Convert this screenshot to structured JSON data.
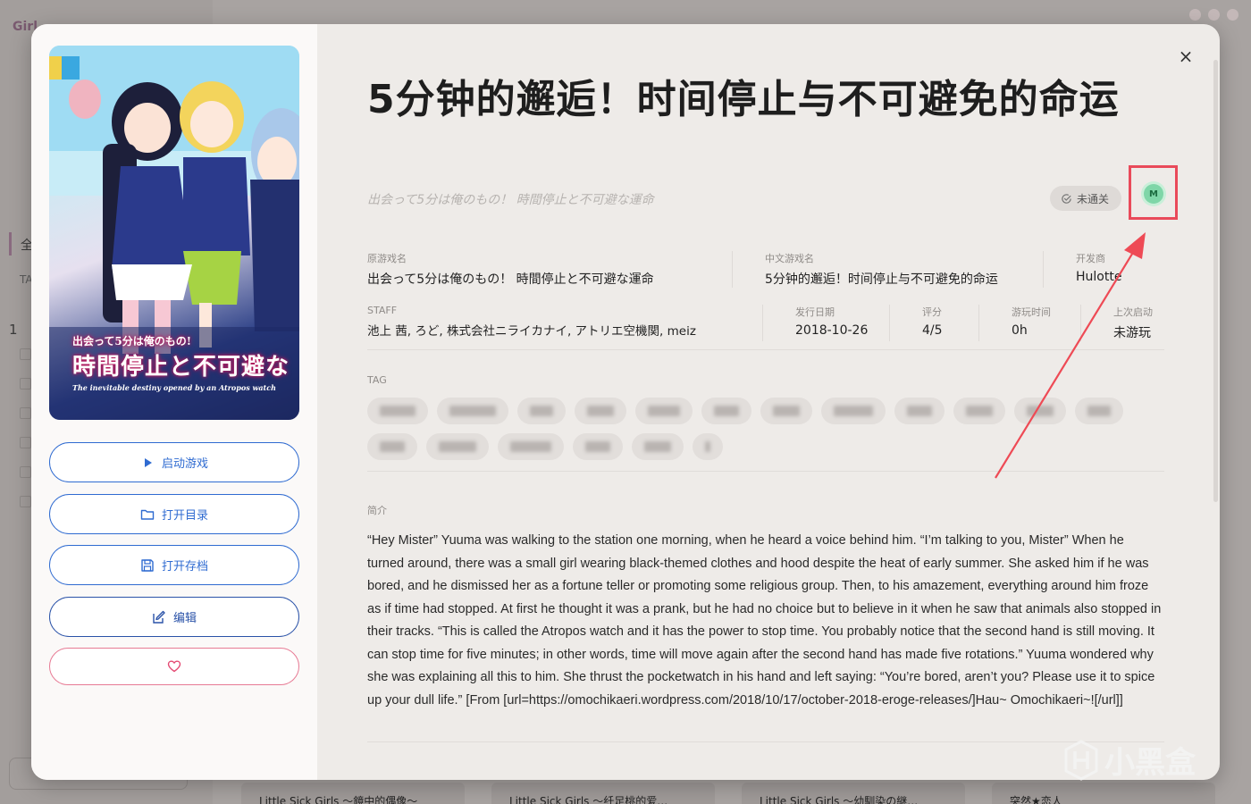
{
  "background": {
    "app_title": "Girl",
    "tab_label": "全",
    "tag_label": "TA",
    "page_number": "1",
    "cards": [
      "Little Sick Girls ～鏡中的偶像～",
      "Little Sick Girls ～纤足桃的爱…",
      "Little Sick Girls ～幼馴染の継…",
      "突然★恋人"
    ]
  },
  "detail": {
    "title": "5分钟的邂逅！时间停止与不可避免的命运",
    "subtitle": "出会って5分は俺のもの！ 時間停止と不可避な運命",
    "status_badge": "未通关",
    "m_badge": "M",
    "close_symbol": "×",
    "info_row1": [
      {
        "label": "原游戏名",
        "value": "出会って5分は俺のもの！ 時間停止と不可避な運命"
      },
      {
        "label": "中文游戏名",
        "value": "5分钟的邂逅！时间停止与不可避免的命运"
      },
      {
        "label": "开发商",
        "value": "Hulotte"
      }
    ],
    "info_row2": [
      {
        "label": "STAFF",
        "value": "池上 茜, ろど, 株式会社ニライカナイ, アトリエ空機関, meiz"
      },
      {
        "label": "发行日期",
        "value": "2018-10-26"
      },
      {
        "label": "评分",
        "value": "4/5"
      },
      {
        "label": "游玩时间",
        "value": "0h"
      },
      {
        "label": "上次启动",
        "value": "未游玩"
      }
    ],
    "tag_section_label": "TAG",
    "desc_section_label": "简介",
    "description": "“Hey Mister” Yuuma was walking to the station one morning, when he heard a voice behind him. “I’m talking to you, Mister” When he turned around, there was a small girl wearing black-themed clothes and hood despite the heat of early summer. She asked him if he was bored, and he dismissed her as a fortune teller or promoting some religious group. Then, to his amazement, everything around him froze as if time had stopped. At first he thought it was a prank, but he had no choice but to believe in it when he saw that animals also stopped in their tracks. “This is called the Atropos watch and it has the power to stop time. You probably notice that the second hand is still moving. It can stop time for five minutes; in other words, time will move again after the second hand has made five rotations.” Yuuma wondered why she was explaining all this to him. She thrust the pocketwatch in his hand and left saying: “You’re bored, aren’t you? Please use it to spice up your dull life.” [From [url=https://omochikaeri.wordpress.com/2018/10/17/october-2018-eroge-releases/]Hau~ Omochikaeri~![/url]]"
  },
  "cover": {
    "logo_line1": "出会って5分は俺のもの!",
    "logo_line2": "時間停止と不可避な",
    "logo_line3": "The inevitable destiny opened by an Atropos watch"
  },
  "actions": {
    "launch": "启动游戏",
    "open_dir": "打开目录",
    "open_save": "打开存档",
    "edit": "编辑"
  },
  "watermark": {
    "text": "小黑盒"
  },
  "colors": {
    "accent": "#2f6bd1",
    "favorite": "#e44a73",
    "highlight_box": "#e94a5a"
  }
}
